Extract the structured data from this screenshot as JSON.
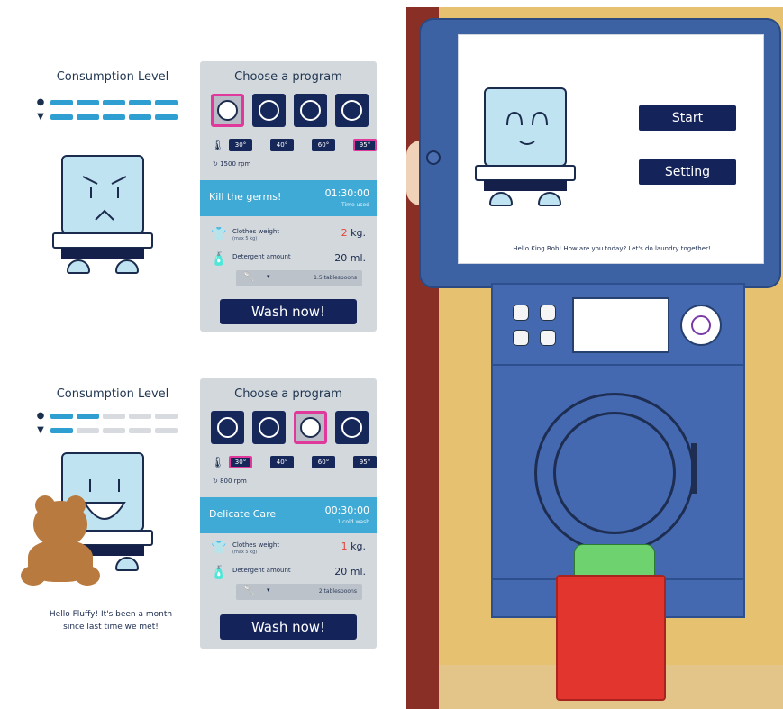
{
  "top_panel": {
    "consumption_title": "Consumption Level",
    "water_level": 1.0,
    "detergent_level": 1.0,
    "program_title": "Choose a program",
    "selected_program_index": 0,
    "temperatures": [
      "30°",
      "40°",
      "60°",
      "95°"
    ],
    "selected_temperature_index": 3,
    "spin": "1500 rpm",
    "program_name": "Kill the germs!",
    "program_time": "01:30:00",
    "program_time_sub": "Time used",
    "clothes_weight_label": "Clothes weight",
    "clothes_weight_sub": "(max 5 kg)",
    "clothes_weight_value": "2",
    "clothes_weight_unit": "kg.",
    "detergent_label": "Detergent amount",
    "detergent_value": "20 ml.",
    "spoon_value": "1.5 tablespoons",
    "wash_button": "Wash now!"
  },
  "bottom_panel": {
    "consumption_title": "Consumption Level",
    "water_level": 0.4,
    "detergent_level": 0.2,
    "program_title": "Choose a program",
    "selected_program_index": 2,
    "temperatures": [
      "30°",
      "40°",
      "60°",
      "95°"
    ],
    "selected_temperature_index": 0,
    "spin": "800 rpm",
    "program_name": "Delicate Care",
    "program_time": "00:30:00",
    "program_time_sub": "1 cold wash",
    "clothes_weight_label": "Clothes weight",
    "clothes_weight_sub": "(max 5 kg)",
    "clothes_weight_value": "1",
    "clothes_weight_unit": "kg.",
    "detergent_label": "Detergent amount",
    "detergent_value": "20 ml.",
    "spoon_value": "2 tablespoons",
    "wash_button": "Wash now!",
    "greeting_line1": "Hello Fluffy! It's been a month",
    "greeting_line2": "since last time we met!"
  },
  "tablet": {
    "start_button": "Start",
    "setting_button": "Setting",
    "greeting": "Hello King Bob! How are you today? Let's do laundry together!"
  },
  "colors": {
    "navy": "#14245a",
    "accent_blue": "#3faad6",
    "selection_pink": "#e0389b",
    "panel_gray": "#d3d8dd",
    "machine_blue": "#4569b0"
  },
  "icons": [
    "water-drop-icon",
    "detergent-icon",
    "germ-kill-icon",
    "spin-fan-icon",
    "wool-ball-icon",
    "quick-timer-icon",
    "thermometer-icon",
    "spin-icon",
    "shirt-icon",
    "bottle-icon",
    "spoon-icon"
  ]
}
